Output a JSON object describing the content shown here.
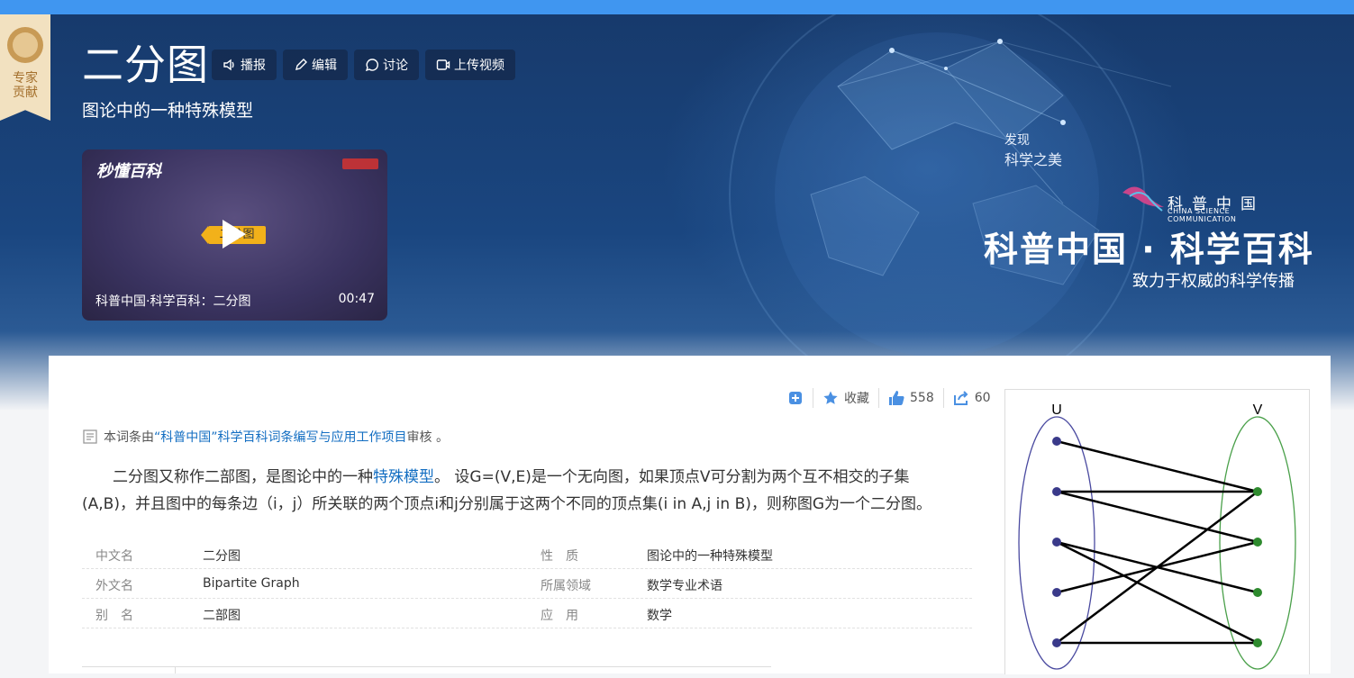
{
  "badge": {
    "line1": "专家",
    "line2": "贡献"
  },
  "header": {
    "title": "二分图",
    "subtitle": "图论中的一种特殊模型",
    "actions": [
      {
        "label": "播报",
        "icon": "speaker-icon"
      },
      {
        "label": "编辑",
        "icon": "pencil-icon"
      },
      {
        "label": "讨论",
        "icon": "chat-icon"
      },
      {
        "label": "上传视频",
        "icon": "video-upload-icon"
      }
    ]
  },
  "video": {
    "logo": "秒懂百科",
    "tag": "二分图",
    "caption": "科普中国·科学百科：二分图",
    "duration": "00:47"
  },
  "brand": {
    "discover_line1": "发现",
    "discover_line2": "科学之美",
    "logo_name": "科普中国",
    "logo_en": "CHINA SCIENCE COMMUNICATION",
    "title": "科普中国 · 科学百科",
    "slogan": "致力于权威的科学传播"
  },
  "toolbar": {
    "favorite_label": "收藏",
    "likes": "558",
    "shares": "60"
  },
  "audit": {
    "prefix": "本词条由",
    "link": "“科普中国”科学百科词条编写与应用工作项目",
    "suffix": " 审核 。"
  },
  "summary": {
    "part1": "二分图又称作二部图，是图论中的一种",
    "link": "特殊模型",
    "part2": "。 设G=(V,E)是一个无向图，如果顶点V可分割为两个互不相交的子集(A,B)，并且图中的每条边（i，j）所关联的两个顶点i和j分别属于这两个不同的顶点集(i in A,j in B)，则称图G为一个二分图。"
  },
  "basic_info": [
    {
      "k1": "中文名",
      "v1": "二分图",
      "k2": "性　质",
      "v2": "图论中的一种特殊模型"
    },
    {
      "k1": "外文名",
      "v1": "Bipartite Graph",
      "k2": "所属领域",
      "v2": "数学专业术语"
    },
    {
      "k1": "别　名",
      "v1": "二部图",
      "k2": "应　用",
      "v2": "数学"
    }
  ],
  "figure": {
    "label_u": "U",
    "label_v": "V"
  }
}
